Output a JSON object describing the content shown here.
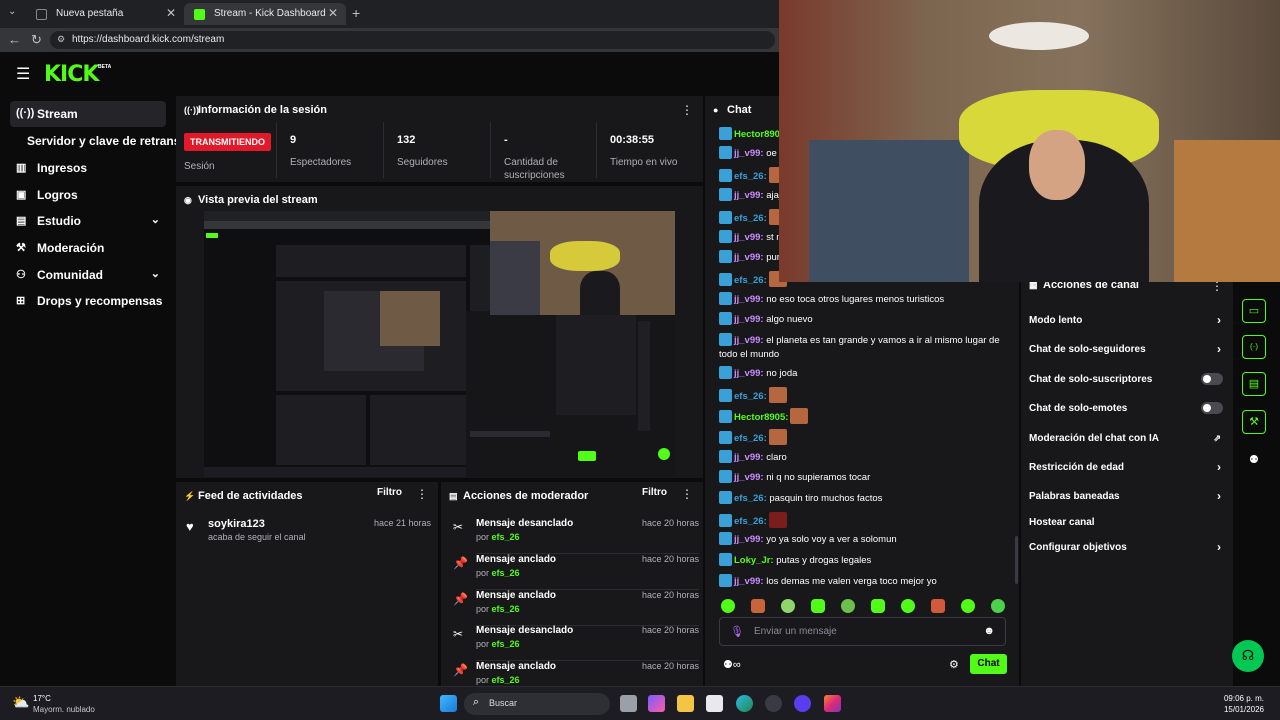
{
  "browser": {
    "tabs": [
      {
        "label": "Nueva pestaña"
      },
      {
        "label": "Stream - Kick Dashboard"
      }
    ],
    "url": "https://dashboard.kick.com/stream"
  },
  "brand": {
    "logo": "KICK",
    "beta": "BETA",
    "accent": "#53fc18"
  },
  "sidebar": {
    "items": [
      {
        "label": "Stream",
        "icon": "broadcast-icon"
      },
      {
        "label": "Servidor y clave de retransm"
      },
      {
        "label": "Ingresos",
        "icon": "chart-icon"
      },
      {
        "label": "Logros",
        "icon": "trophy-icon"
      },
      {
        "label": "Estudio",
        "icon": "studio-icon"
      },
      {
        "label": "Moderación",
        "icon": "gavel-icon"
      },
      {
        "label": "Comunidad",
        "icon": "people-icon"
      },
      {
        "label": "Drops y recompensas",
        "icon": "gift-icon"
      }
    ]
  },
  "session": {
    "title": "Información de la sesión",
    "status_badge": "TRANSMITIENDO",
    "status_label": "Sesión",
    "stats": [
      {
        "value": "9",
        "label": "Espectadores"
      },
      {
        "value": "132",
        "label": "Seguidores"
      },
      {
        "value": "-",
        "label": "Cantidad de suscripciones"
      },
      {
        "value": "00:38:55",
        "label": "Tiempo en vivo"
      }
    ]
  },
  "preview": {
    "title": "Vista previa del stream"
  },
  "activity": {
    "title": "Feed de actividades",
    "filter": "Filtro",
    "items": [
      {
        "user": "soykira123",
        "text": "acaba de seguir el canal",
        "time": "hace 21 horas"
      }
    ]
  },
  "mod_actions": {
    "title": "Acciones de moderador",
    "filter": "Filtro",
    "items": [
      {
        "title": "Mensaje desanclado",
        "by": "por",
        "user": "efs_26",
        "time": "hace 20 horas",
        "icon": "unpin-icon"
      },
      {
        "title": "Mensaje anclado",
        "by": "por",
        "user": "efs_26",
        "time": "hace 20 horas",
        "icon": "pin-icon"
      },
      {
        "title": "Mensaje anclado",
        "by": "por",
        "user": "efs_26",
        "time": "hace 20 horas",
        "icon": "pin-icon"
      },
      {
        "title": "Mensaje desanclado",
        "by": "por",
        "user": "efs_26",
        "time": "hace 20 horas",
        "icon": "unpin-icon"
      },
      {
        "title": "Mensaje anclado",
        "by": "por",
        "user": "efs_26",
        "time": "hace 20 horas",
        "icon": "pin-icon"
      }
    ]
  },
  "chat": {
    "title": "Chat",
    "messages": [
      {
        "user": "Hector890",
        "text": ""
      },
      {
        "user": "jj_v99:",
        "text": "oe p"
      },
      {
        "user": "efs_26:",
        "text": ""
      },
      {
        "user": "jj_v99:",
        "text": "ajaj"
      },
      {
        "user": "efs_26:",
        "text": ""
      },
      {
        "user": "jj_v99:",
        "text": "st m"
      },
      {
        "user": "jj_v99:",
        "text": "puro"
      },
      {
        "user": "efs_26:",
        "text": ""
      },
      {
        "user": "jj_v99:",
        "text": "no eso toca otros lugares menos turisticos"
      },
      {
        "user": "jj_v99:",
        "text": "algo nuevo"
      },
      {
        "user": "jj_v99:",
        "text": "el planeta es tan grande y vamos a ir al mismo lugar de todo el mundo"
      },
      {
        "user": "jj_v99:",
        "text": "no joda"
      },
      {
        "user": "efs_26:",
        "text": ""
      },
      {
        "user": "Hector8905:",
        "text": ""
      },
      {
        "user": "efs_26:",
        "text": ""
      },
      {
        "user": "jj_v99:",
        "text": "claro"
      },
      {
        "user": "jj_v99:",
        "text": "ni q no supieramos tocar"
      },
      {
        "user": "efs_26:",
        "text": "pasquin tiro muchos factos"
      },
      {
        "user": "efs_26:",
        "text": ""
      },
      {
        "user": "jj_v99:",
        "text": "yo ya solo voy a ver a solomun"
      },
      {
        "user": "Loky_Jr:",
        "text": "putas y drogas legales"
      },
      {
        "user": "jj_v99:",
        "text": "los demas me valen verga toco mejor yo"
      }
    ],
    "input_placeholder": "Enviar un mensaje",
    "send_label": "Chat"
  },
  "channel_actions": {
    "title": "Acciones de canal",
    "items": [
      {
        "label": "Modo lento"
      },
      {
        "label": "Chat de solo-seguidores"
      },
      {
        "label": "Chat de solo-suscriptores"
      },
      {
        "label": "Chat de solo-emotes"
      },
      {
        "label": "Moderación del chat con IA"
      },
      {
        "label": "Restricción de edad"
      },
      {
        "label": "Palabras baneadas"
      },
      {
        "label": "Hostear canal"
      },
      {
        "label": "Configurar objetivos"
      }
    ]
  },
  "taskbar": {
    "weather_temp": "17°C",
    "weather_desc": "Mayorm. nublado",
    "search": "Buscar",
    "time": "09:06 p. m.",
    "date": "15/01/2026"
  }
}
